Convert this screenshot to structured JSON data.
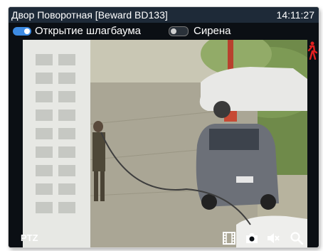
{
  "window": {
    "title": "Двор Поворотная [Beward BD133]",
    "time": "14:11:27"
  },
  "controls": {
    "barrier": {
      "label": "Открытие шлагбаума",
      "on": true
    },
    "siren": {
      "label": "Сирена",
      "on": false
    }
  },
  "bottom_bar": {
    "ptz_label": "PTZ",
    "icons": [
      "film-icon",
      "camera-icon",
      "mute-icon",
      "search-icon"
    ]
  },
  "colors": {
    "title_bar": "#1e2a38",
    "toggle_on": "#3d8be3",
    "motion_indicator": "#e02020"
  }
}
